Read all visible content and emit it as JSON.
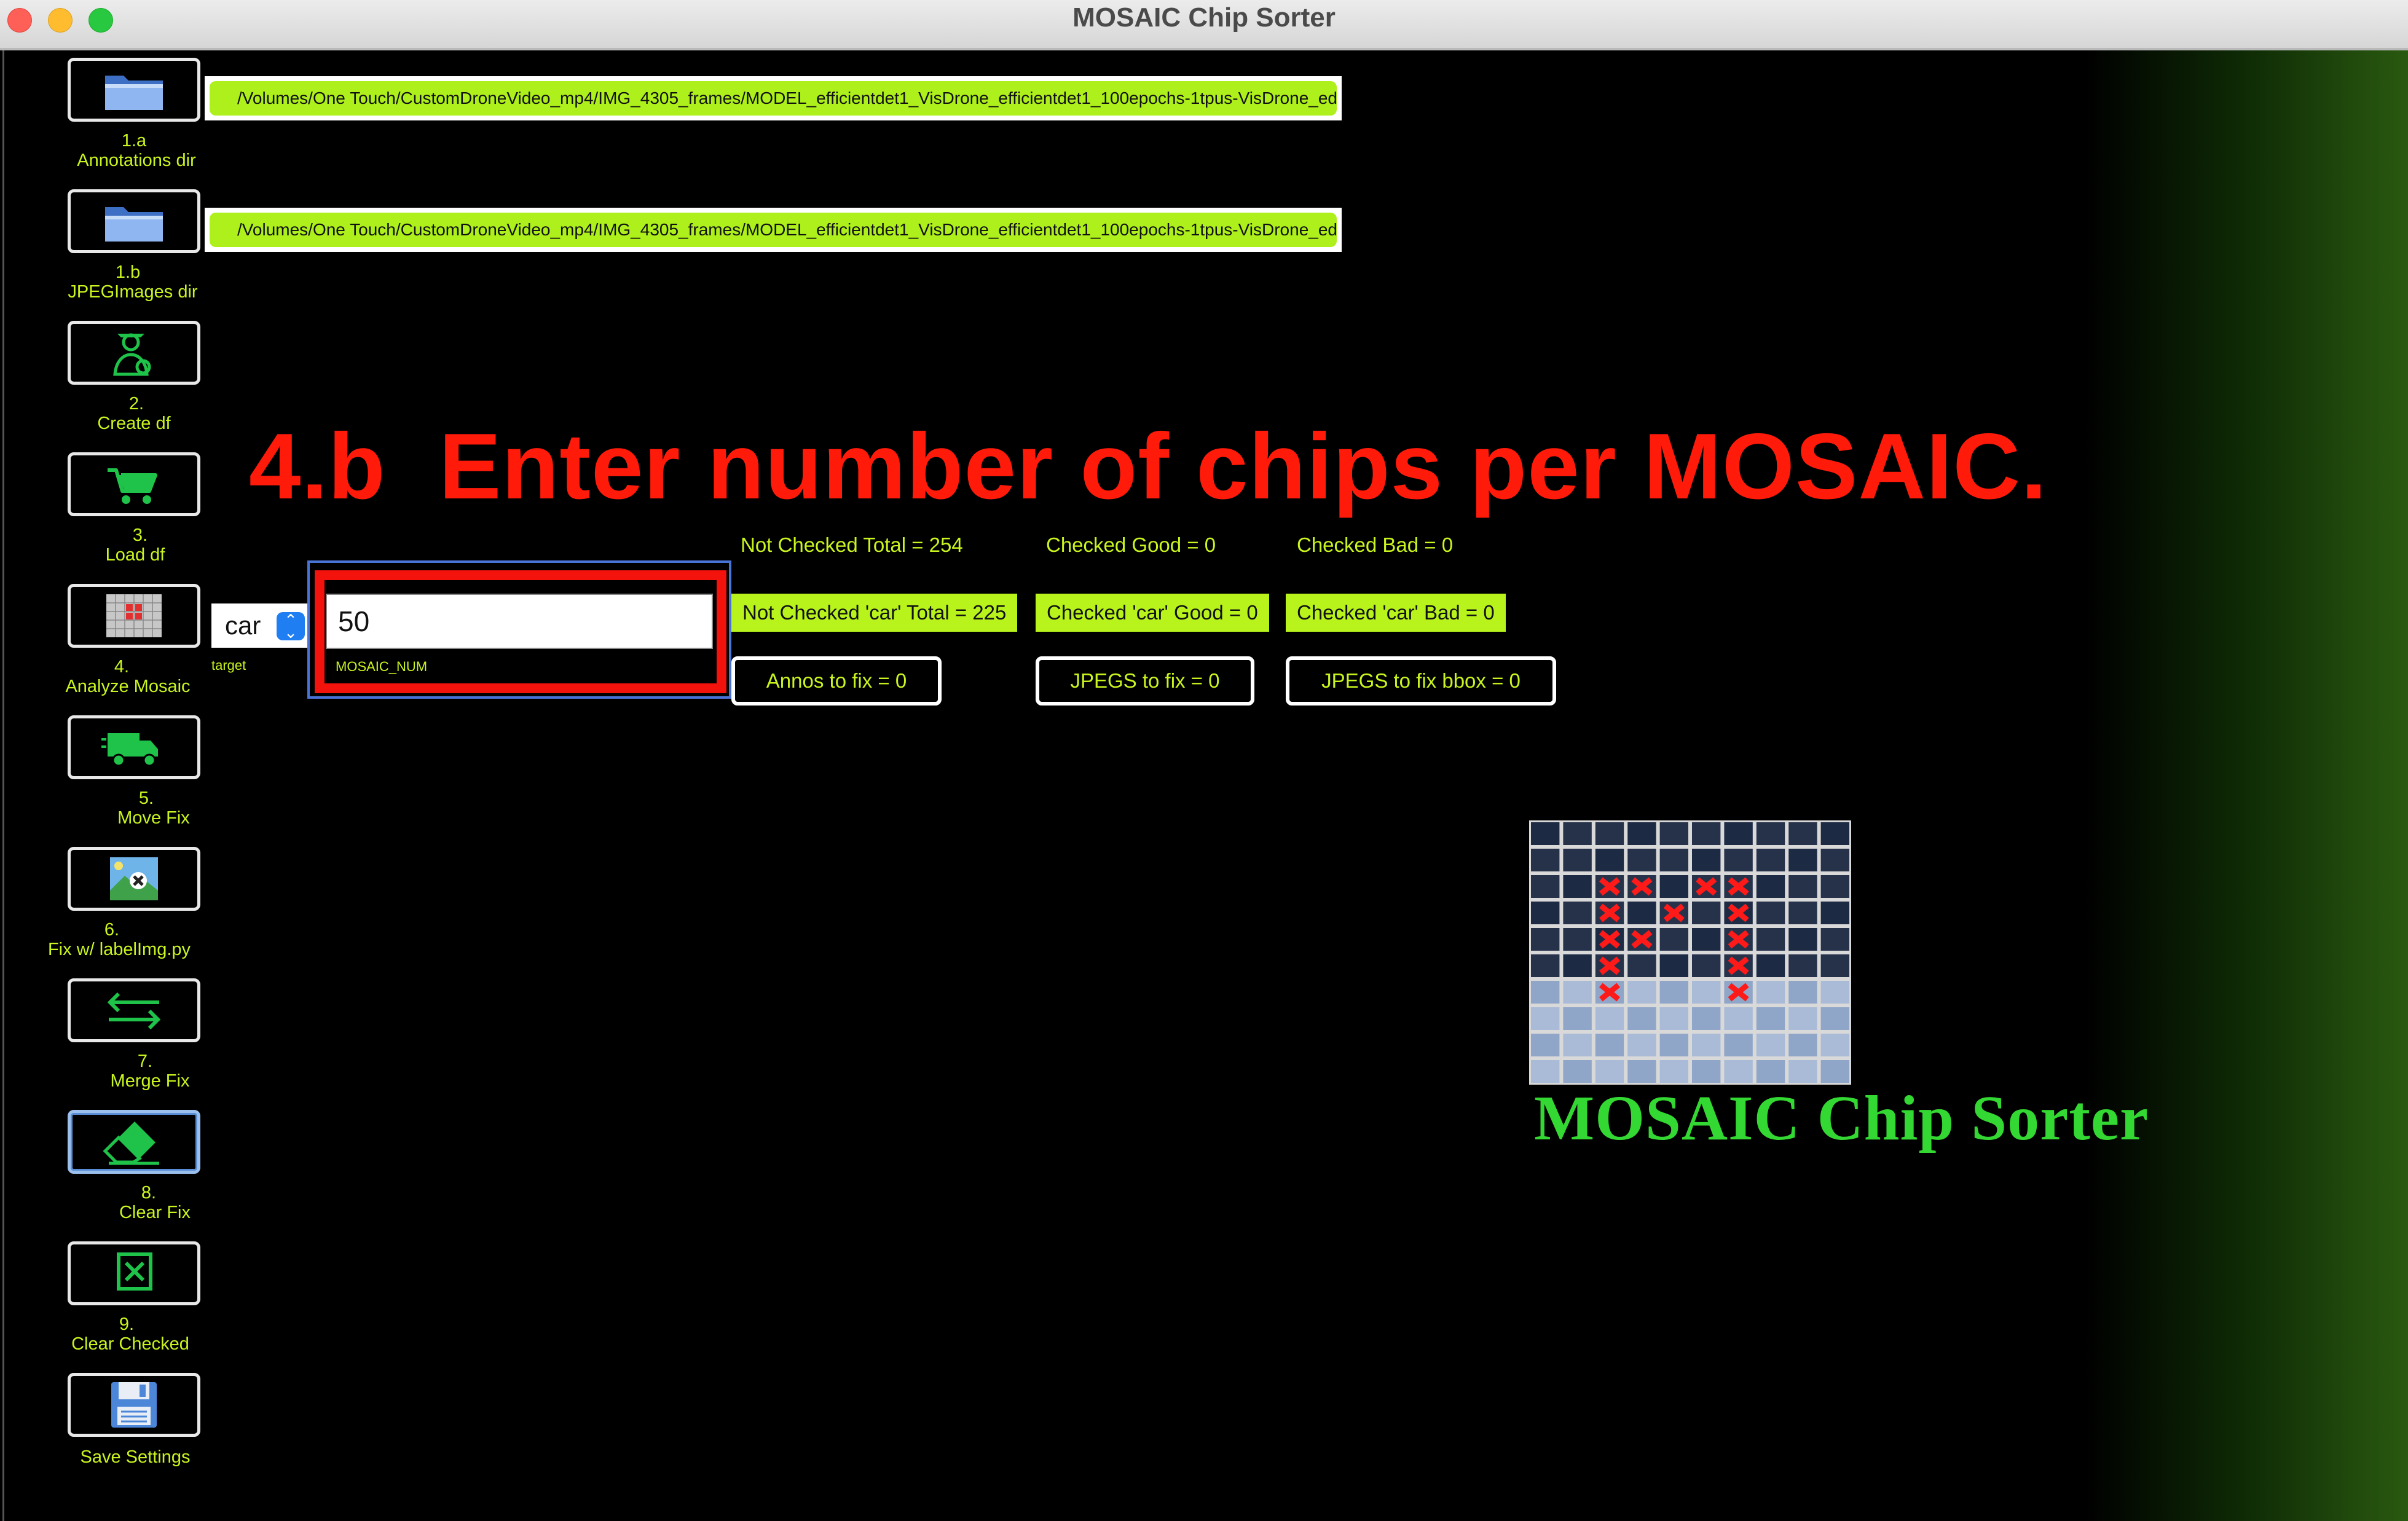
{
  "window": {
    "title": "MOSAIC Chip Sorter"
  },
  "paths": {
    "annotations": "/Volumes/One Touch/CustomDroneVideo_mp4/IMG_4305_frames/MODEL_efficientdet1_VisDrone_efficientdet1_100epochs-1tpus-VisDrone_edgetpu",
    "jpeg": "/Volumes/One Touch/CustomDroneVideo_mp4/IMG_4305_frames/MODEL_efficientdet1_VisDrone_efficientdet1_100epochs-1tpus-VisDrone_edgetpu"
  },
  "sidebar": {
    "items": [
      {
        "num": "1.a",
        "label": "Annotations dir",
        "icon": "folder-icon"
      },
      {
        "num": "1.b",
        "label": "JPEGImages dir",
        "icon": "folder-icon"
      },
      {
        "num": "2.",
        "label": "Create df",
        "icon": "worker-icon"
      },
      {
        "num": "3.",
        "label": "Load df",
        "icon": "cart-icon"
      },
      {
        "num": "4.",
        "label": "Analyze Mosaic",
        "icon": "mosaic-icon"
      },
      {
        "num": "5.",
        "label": "Move Fix",
        "icon": "truck-icon"
      },
      {
        "num": "6.",
        "label": "Fix w/ labelImg.py",
        "icon": "image-edit-icon"
      },
      {
        "num": "7.",
        "label": "Merge Fix",
        "icon": "arrows-icon"
      },
      {
        "num": "8.",
        "label": "Clear Fix",
        "icon": "eraser-icon"
      },
      {
        "num": "9.",
        "label": "Clear Checked",
        "icon": "clear-box-icon"
      },
      {
        "num": "",
        "label": "Save Settings",
        "icon": "floppy-icon"
      }
    ]
  },
  "instruction": "4.b  Enter number of chips per MOSAIC.",
  "target": {
    "value": "car",
    "caption": "target"
  },
  "mosaic_num": {
    "value": "50",
    "caption": "MOSAIC_NUM"
  },
  "stats": {
    "not_checked_total": "Not Checked Total = 254",
    "checked_good": "Checked Good = 0",
    "checked_bad": "Checked Bad = 0",
    "not_checked_car": "Not Checked 'car' Total = 225",
    "checked_car_good": "Checked 'car' Good = 0",
    "checked_car_bad": "Checked 'car' Bad = 0"
  },
  "fix_buttons": {
    "annos": "Annos to fix = 0",
    "jpegs": "JPEGS to fix = 0",
    "jpegs_bbox": "JPEGS to fix bbox = 0"
  },
  "logo": {
    "text": "MOSAIC Chip Sorter"
  },
  "colors": {
    "accent_green": "#c9f51f",
    "badge_green": "#b8f41c",
    "instruction_red": "#ff1a0a",
    "logo_green": "#34d832"
  }
}
